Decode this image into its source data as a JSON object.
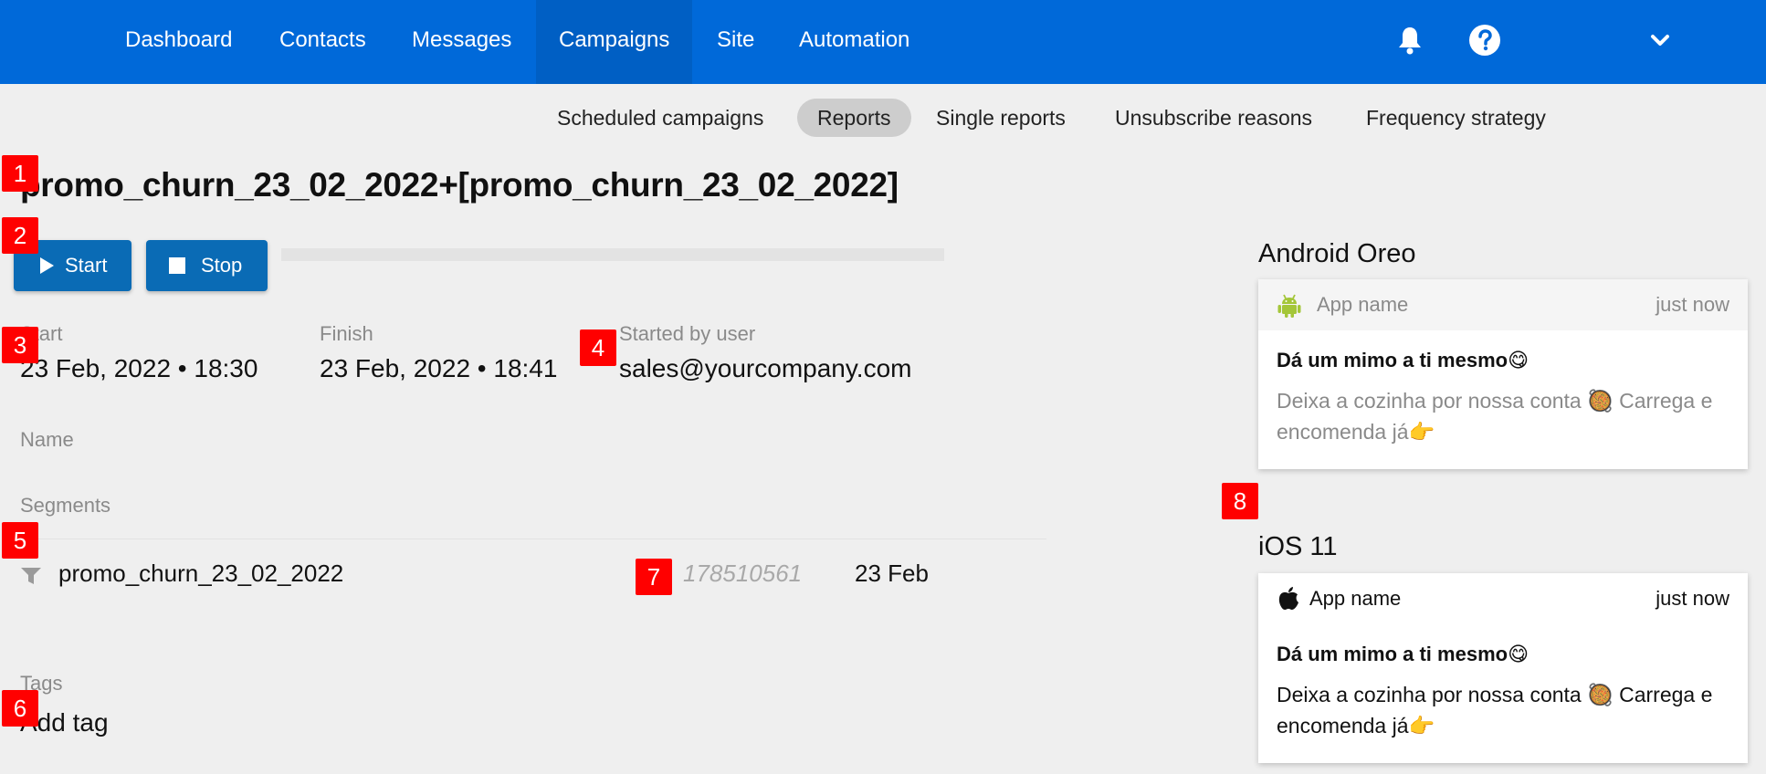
{
  "nav": {
    "items": [
      "Dashboard",
      "Contacts",
      "Messages",
      "Campaigns",
      "Site",
      "Automation"
    ],
    "active": "Campaigns",
    "icons": [
      "bell-icon",
      "help-icon",
      "chevron-down-icon"
    ]
  },
  "subnav": {
    "items": [
      "Scheduled campaigns",
      "Reports",
      "Single reports",
      "Unsubscribe reasons",
      "Frequency strategy"
    ],
    "active": "Reports"
  },
  "campaign": {
    "title": "promo_churn_23_02_2022+[promo_churn_23_02_2022]",
    "start_button": "Start",
    "stop_button": "Stop",
    "progress": 0
  },
  "details": {
    "start_label": "Start",
    "start_value": "23 Feb, 2022 • 18:30",
    "finish_label": "Finish",
    "finish_value": "23 Feb, 2022 • 18:41",
    "user_label": "Started by user",
    "user_value": "sales@yourcompany.com",
    "name_label": "Name",
    "segments_label": "Segments",
    "tags_label": "Tags",
    "add_tag": "Add tag"
  },
  "segments": [
    {
      "name": "promo_churn_23_02_2022",
      "count": "178510561",
      "date": "23 Feb"
    }
  ],
  "previews": {
    "android": {
      "platform": "Android Oreo",
      "app": "App name",
      "time": "just now",
      "title": "Dá um mimo a ti mesmo😋",
      "text": "Deixa a cozinha por nossa conta 🥘 Carrega e encomenda já👉"
    },
    "ios": {
      "platform": "iOS 11",
      "app": "App name",
      "time": "just now",
      "title": "Dá um mimo a ti mesmo😋",
      "text": "Deixa a cozinha por nossa conta 🥘 Carrega e encomenda já👉"
    }
  },
  "badges": [
    "1",
    "2",
    "3",
    "4",
    "5",
    "6",
    "7",
    "8"
  ],
  "colors": {
    "nav": "#0069d9",
    "button": "#0a6bb5",
    "badge": "#ff0000",
    "android": "#a4c639"
  }
}
